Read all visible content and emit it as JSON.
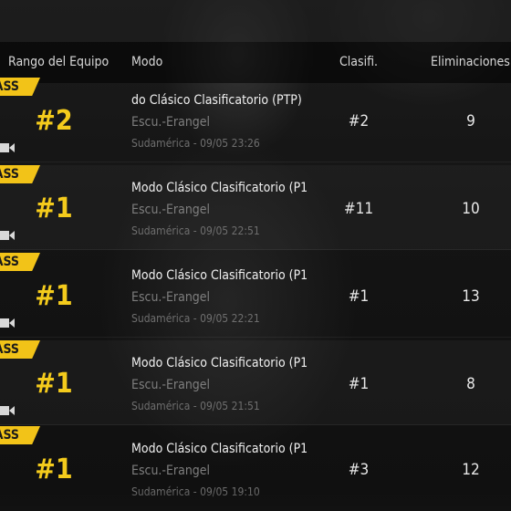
{
  "header": {
    "team_rank": "Rango del Equipo",
    "mode": "Modo",
    "rank": "Clasifi.",
    "kills": "Eliminaciones"
  },
  "pass_label": "PASS",
  "colors": {
    "accent": "#f2c318",
    "rank_text": "#f4cb1c",
    "muted": "#7e7e7e"
  },
  "matches": [
    {
      "team_rank": "#2",
      "mode": "do Clásico Clasificatorio (PTP)",
      "map": "Escu.-Erangel",
      "region_time": "Sudamérica - 09/05 23:26",
      "rank": "#2",
      "kills": "9"
    },
    {
      "team_rank": "#1",
      "mode": "Modo Clásico Clasificatorio (P1",
      "map": "Escu.-Erangel",
      "region_time": "Sudamérica - 09/05 22:51",
      "rank": "#11",
      "kills": "10"
    },
    {
      "team_rank": "#1",
      "mode": "Modo Clásico Clasificatorio (P1",
      "map": "Escu.-Erangel",
      "region_time": "Sudamérica - 09/05 22:21",
      "rank": "#1",
      "kills": "13"
    },
    {
      "team_rank": "#1",
      "mode": "Modo Clásico Clasificatorio (P1",
      "map": "Escu.-Erangel",
      "region_time": "Sudamérica - 09/05 21:51",
      "rank": "#1",
      "kills": "8"
    },
    {
      "team_rank": "#1",
      "mode": "Modo Clásico Clasificatorio (P1",
      "map": "Escu.-Erangel",
      "region_time": "Sudamérica - 09/05 19:10",
      "rank": "#3",
      "kills": "12"
    }
  ]
}
